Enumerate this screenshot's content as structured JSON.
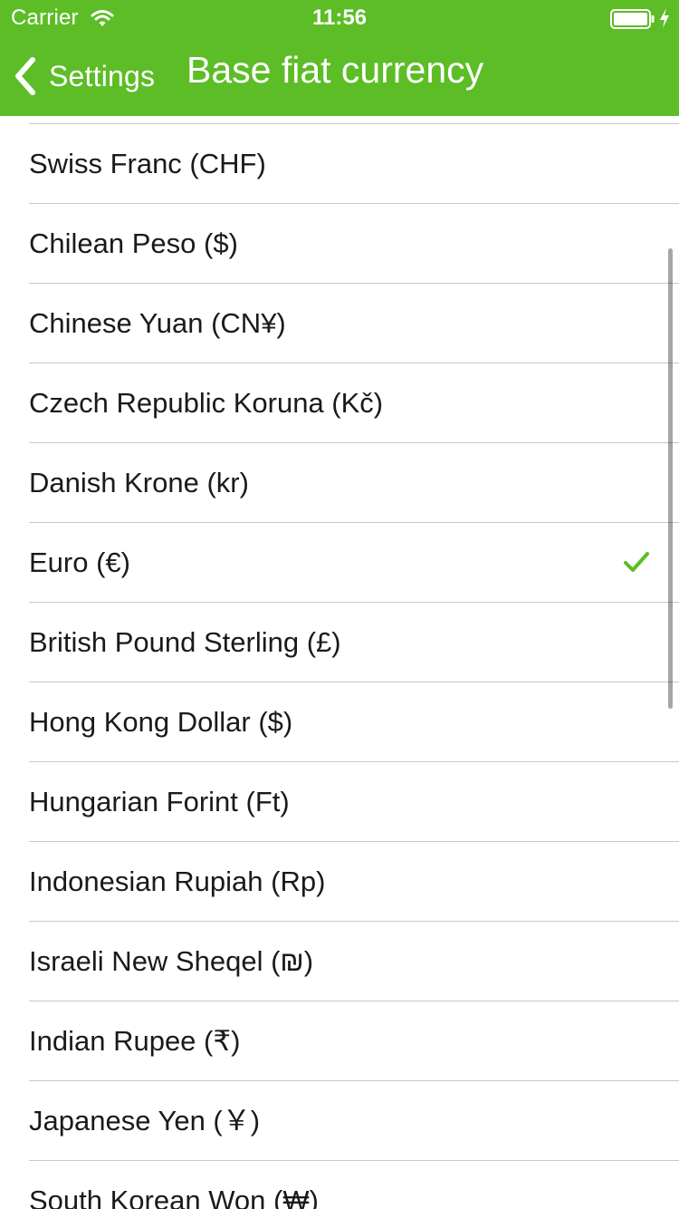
{
  "status_bar": {
    "carrier": "Carrier",
    "time": "11:56"
  },
  "nav": {
    "back_label": "Settings",
    "title": "Base fiat currency"
  },
  "colors": {
    "accent": "#5cbd26",
    "separator": "#c8c7cc"
  },
  "currencies": [
    {
      "label": "Swiss Franc (CHF)",
      "selected": false
    },
    {
      "label": "Chilean Peso ($)",
      "selected": false
    },
    {
      "label": "Chinese Yuan (CN¥)",
      "selected": false
    },
    {
      "label": "Czech Republic Koruna (Kč)",
      "selected": false
    },
    {
      "label": "Danish Krone (kr)",
      "selected": false
    },
    {
      "label": "Euro (€)",
      "selected": true
    },
    {
      "label": "British Pound Sterling (£)",
      "selected": false
    },
    {
      "label": "Hong Kong Dollar ($)",
      "selected": false
    },
    {
      "label": "Hungarian Forint (Ft)",
      "selected": false
    },
    {
      "label": "Indonesian Rupiah (Rp)",
      "selected": false
    },
    {
      "label": "Israeli New Sheqel (₪)",
      "selected": false
    },
    {
      "label": "Indian Rupee (₹)",
      "selected": false
    },
    {
      "label": "Japanese Yen (￥)",
      "selected": false
    },
    {
      "label": "South Korean Won (₩)",
      "selected": false
    }
  ]
}
